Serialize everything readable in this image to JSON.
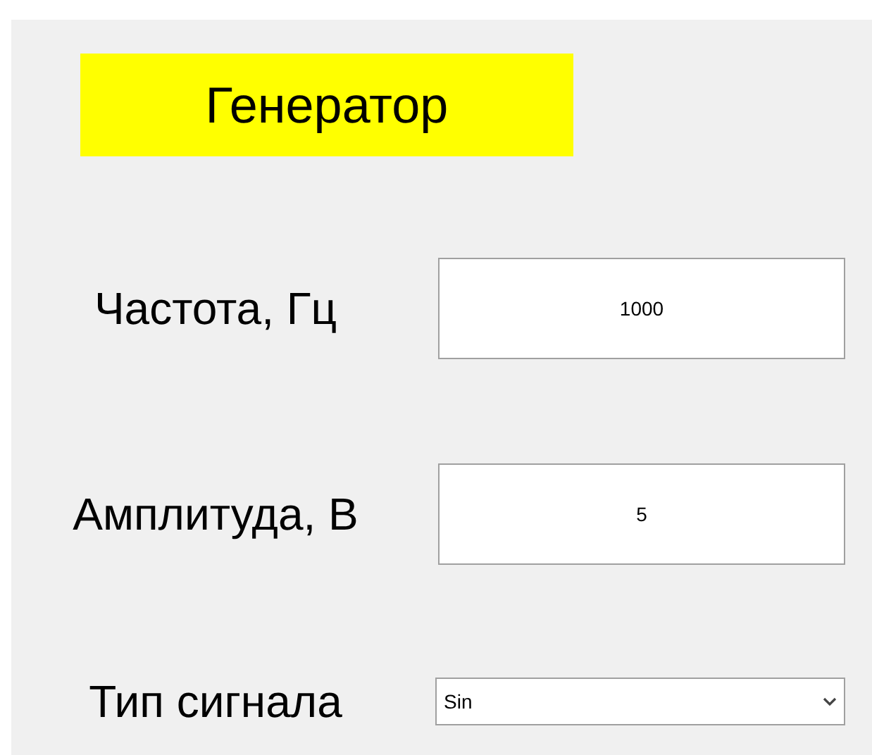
{
  "title": "Генератор",
  "fields": [
    {
      "kind": "text",
      "label": "Частота, Гц",
      "value": "1000"
    },
    {
      "kind": "text",
      "label": "Амплитуда, В",
      "value": "5"
    },
    {
      "kind": "select",
      "label": "Тип сигнала",
      "value": "Sin"
    }
  ]
}
